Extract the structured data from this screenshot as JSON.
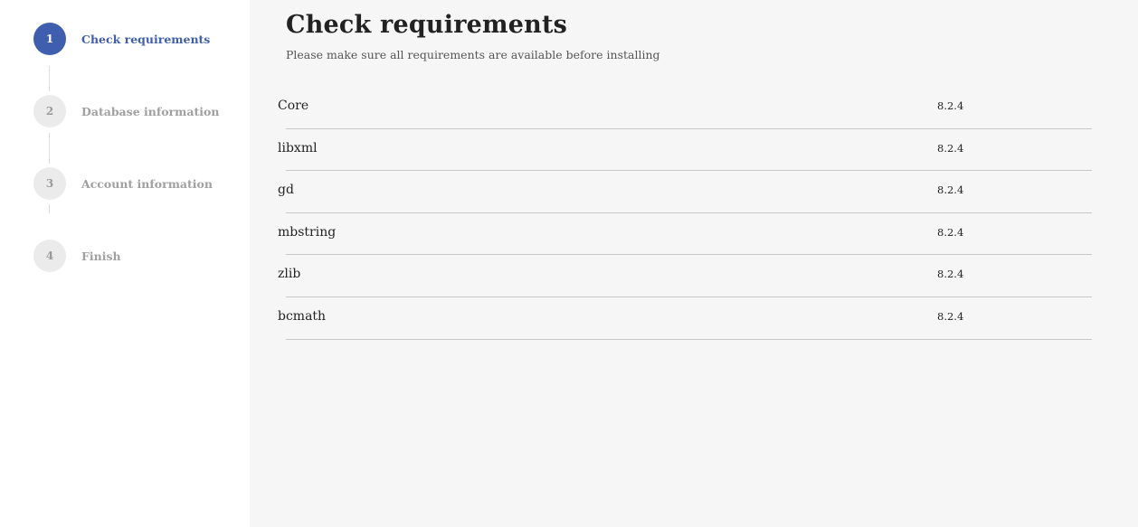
{
  "steps": [
    {
      "number": "1",
      "label": "Check requirements",
      "active": true
    },
    {
      "number": "2",
      "label": "Database information",
      "active": false
    },
    {
      "number": "3",
      "label": "Account information",
      "active": false
    },
    {
      "number": "4",
      "label": "Finish",
      "active": false
    }
  ],
  "main": {
    "title": "Check requirements",
    "subtitle": "Please make sure all requirements are available before installing"
  },
  "requirements": [
    {
      "name": "Core",
      "version": "8.2.4"
    },
    {
      "name": "libxml",
      "version": "8.2.4"
    },
    {
      "name": "gd",
      "version": "8.2.4"
    },
    {
      "name": "mbstring",
      "version": "8.2.4"
    },
    {
      "name": "zlib",
      "version": "8.2.4"
    },
    {
      "name": "bcmath",
      "version": "8.2.4"
    }
  ],
  "colors": {
    "accent": "#3f5fae",
    "inactive_circle": "#ebebeb",
    "inactive_text": "#a0a0a0",
    "content_bg": "#f6f6f6",
    "sidebar_bg": "#ffffff"
  }
}
